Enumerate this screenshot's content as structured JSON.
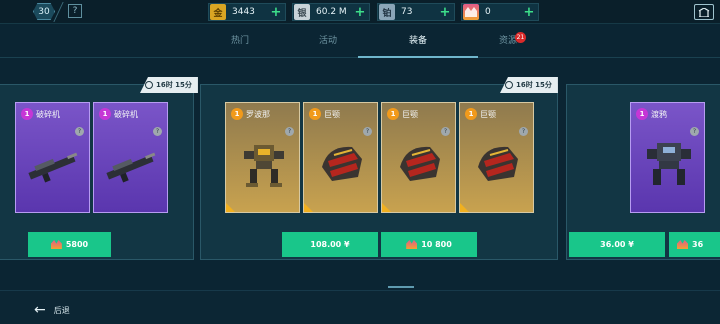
{
  "topbar": {
    "level": "30",
    "help_glyph": "?",
    "resources": [
      {
        "icon": "gold-coin-icon",
        "glyph": "金",
        "value": "3443",
        "plus": "+"
      },
      {
        "icon": "silver-coin-icon",
        "glyph": "银",
        "value": "60.2 M",
        "plus": "+"
      },
      {
        "icon": "platinum-icon",
        "glyph": "铂",
        "value": "73",
        "plus": "+"
      },
      {
        "icon": "key-icon",
        "glyph": "",
        "value": "0",
        "plus": "+"
      }
    ]
  },
  "tabs": [
    {
      "label": "热门"
    },
    {
      "label": "活动"
    },
    {
      "label": "装备",
      "active": true
    },
    {
      "label": "资源",
      "badge": "21"
    }
  ],
  "panels": [
    {
      "timer": "16时 15分",
      "cards": [
        {
          "name": "破碎机",
          "badge": "1",
          "rarity": "purple"
        },
        {
          "name": "破碎机",
          "badge": "1",
          "rarity": "purple"
        }
      ],
      "price": "5800",
      "price_currency": "key"
    },
    {
      "timer": "16时 15分",
      "cards": [
        {
          "name": "罗波那",
          "badge": "1",
          "rarity": "gold"
        },
        {
          "name": "巨颚",
          "badge": "1",
          "rarity": "gold"
        },
        {
          "name": "巨颚",
          "badge": "1",
          "rarity": "gold"
        },
        {
          "name": "巨颚",
          "badge": "1",
          "rarity": "gold"
        }
      ],
      "prices": [
        "108.00 ¥",
        "10 800"
      ]
    },
    {
      "cards": [
        {
          "name": "渡鸦",
          "badge": "1",
          "rarity": "purple"
        }
      ],
      "prices": [
        "36.00 ¥",
        "36"
      ]
    }
  ],
  "bottom": {
    "back_label": "后退"
  },
  "colors": {
    "accent_green": "#19c68a",
    "purple": "#7a55c8",
    "gold": "#c8a24f"
  }
}
